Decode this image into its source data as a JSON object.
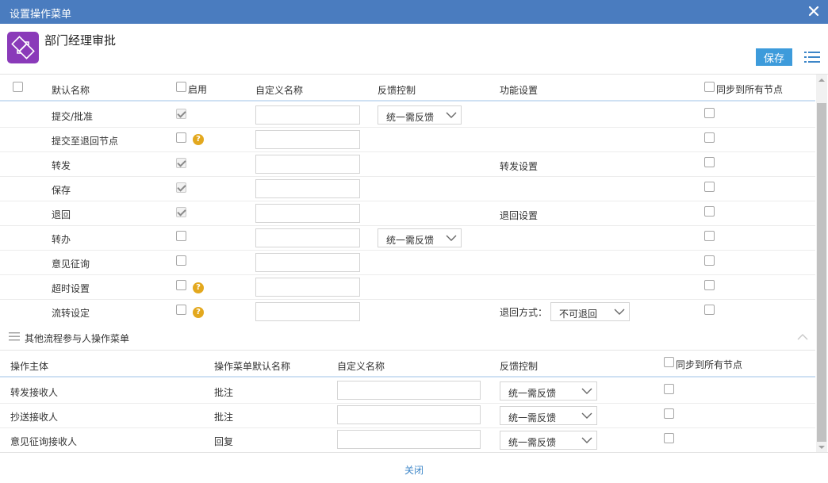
{
  "window": {
    "title": "设置操作菜单"
  },
  "header": {
    "node_name": "部门经理审批",
    "save_label": "保存"
  },
  "table1": {
    "headers": {
      "default_name": "默认名称",
      "enable": "启用",
      "custom_name": "自定义名称",
      "feedback": "反馈控制",
      "function": "功能设置",
      "sync": "同步到所有节点"
    },
    "rows": [
      {
        "name": "提交/批准",
        "enabled": true,
        "help": false,
        "custom": "",
        "feedback": "统一需反馈",
        "function": "",
        "function_label": "",
        "function_value": "",
        "sync": false
      },
      {
        "name": "提交至退回节点",
        "enabled": false,
        "help": true,
        "custom": "",
        "feedback": "",
        "function": "",
        "function_label": "",
        "function_value": "",
        "sync": false
      },
      {
        "name": "转发",
        "enabled": true,
        "help": false,
        "custom": "",
        "feedback": "",
        "function": "转发设置",
        "function_label": "",
        "function_value": "",
        "sync": false
      },
      {
        "name": "保存",
        "enabled": true,
        "help": false,
        "custom": "",
        "feedback": "",
        "function": "",
        "function_label": "",
        "function_value": "",
        "sync": false
      },
      {
        "name": "退回",
        "enabled": true,
        "help": false,
        "custom": "",
        "feedback": "",
        "function": "退回设置",
        "function_label": "",
        "function_value": "",
        "sync": false
      },
      {
        "name": "转办",
        "enabled": false,
        "help": false,
        "custom": "",
        "feedback": "统一需反馈",
        "function": "",
        "function_label": "",
        "function_value": "",
        "sync": false
      },
      {
        "name": "意见征询",
        "enabled": false,
        "help": false,
        "custom": "",
        "feedback": "",
        "function": "",
        "function_label": "",
        "function_value": "",
        "sync": false
      },
      {
        "name": "超时设置",
        "enabled": false,
        "help": true,
        "custom": "",
        "feedback": "",
        "function": "",
        "function_label": "",
        "function_value": "",
        "sync": false
      },
      {
        "name": "流转设定",
        "enabled": false,
        "help": true,
        "custom": "",
        "feedback": "",
        "function": "",
        "function_label": "退回方式：",
        "function_value": "不可退回",
        "sync": false
      }
    ]
  },
  "section2": {
    "title": "其他流程参与人操作菜单",
    "headers": {
      "subject": "操作主体",
      "menu_default": "操作菜单默认名称",
      "custom_name": "自定义名称",
      "feedback": "反馈控制",
      "sync": "同步到所有节点"
    },
    "rows": [
      {
        "subject": "转发接收人",
        "menu": "批注",
        "custom": "",
        "feedback": "统一需反馈",
        "sync": false
      },
      {
        "subject": "抄送接收人",
        "menu": "批注",
        "custom": "",
        "feedback": "统一需反馈",
        "sync": false
      },
      {
        "subject": "意见征询接收人",
        "menu": "回复",
        "custom": "",
        "feedback": "统一需反馈",
        "sync": false
      }
    ]
  },
  "footer": {
    "close_label": "关闭"
  },
  "icons": {
    "close": "close-icon",
    "node": "workflow-node-icon",
    "list": "list-icon",
    "help": "help-icon",
    "chevron": "chevron-down-icon",
    "menu": "menu-icon",
    "collapse": "chevron-up-icon"
  },
  "colors": {
    "titlebar": "#4a7cbf",
    "save": "#3d9bdb",
    "node_icon": "#8a3ab9",
    "help": "#e3a81e",
    "link": "#3d86c8"
  }
}
